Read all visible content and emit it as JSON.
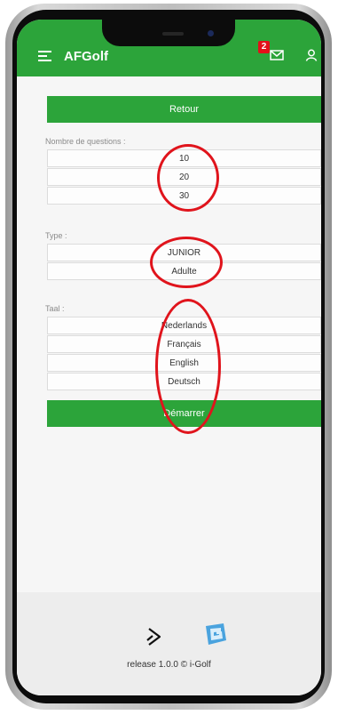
{
  "app": {
    "title": "AFGolf",
    "notification_count": "2"
  },
  "back_button": {
    "label": "Retour"
  },
  "questions": {
    "label": "Nombre de questions :",
    "options": [
      "10",
      "20",
      "30"
    ]
  },
  "type": {
    "label": "Type :",
    "options": [
      "JUNIOR",
      "Adulte"
    ]
  },
  "language": {
    "label": "Taal :",
    "options": [
      "Nederlands",
      "Français",
      "English",
      "Deutsch"
    ]
  },
  "start_button": {
    "label": "Démarrer"
  },
  "footer": {
    "release": "release 1.0.0 © i-Golf"
  },
  "colors": {
    "primary": "#2ca43a",
    "highlight": "#e0141c",
    "badge": "#e3101a"
  },
  "icons": [
    "menu-icon",
    "mail-icon",
    "user-icon",
    "play-logo-icon",
    "igolf-logo-icon"
  ]
}
